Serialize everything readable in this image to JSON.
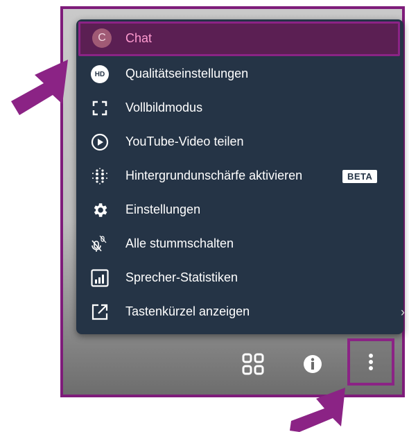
{
  "menu": {
    "items": [
      {
        "label": "Chat",
        "avatar": "C",
        "icon": "avatar-icon"
      },
      {
        "label": "Qualitätseinstellungen",
        "badge": "HD",
        "icon": "hd-icon"
      },
      {
        "label": "Vollbildmodus",
        "icon": "fullscreen-icon"
      },
      {
        "label": "YouTube-Video teilen",
        "icon": "play-circle-icon"
      },
      {
        "label": "Hintergrundunschärfe aktivieren",
        "tag": "BETA",
        "icon": "blur-icon"
      },
      {
        "label": "Einstellungen",
        "icon": "gear-icon"
      },
      {
        "label": "Alle stummschalten",
        "icon": "mute-all-icon"
      },
      {
        "label": "Sprecher-Statistiken",
        "icon": "bar-chart-icon"
      },
      {
        "label": "Tastenkürzel anzeigen",
        "icon": "external-link-icon"
      }
    ]
  },
  "toolbar": {
    "buttons": [
      "tile-view-icon",
      "info-icon",
      "more-vertical-icon"
    ]
  },
  "colors": {
    "menu_bg": "#253446",
    "highlight": "#8b2385",
    "active_text": "#ff9bd0",
    "arrow": "#8b2385"
  }
}
